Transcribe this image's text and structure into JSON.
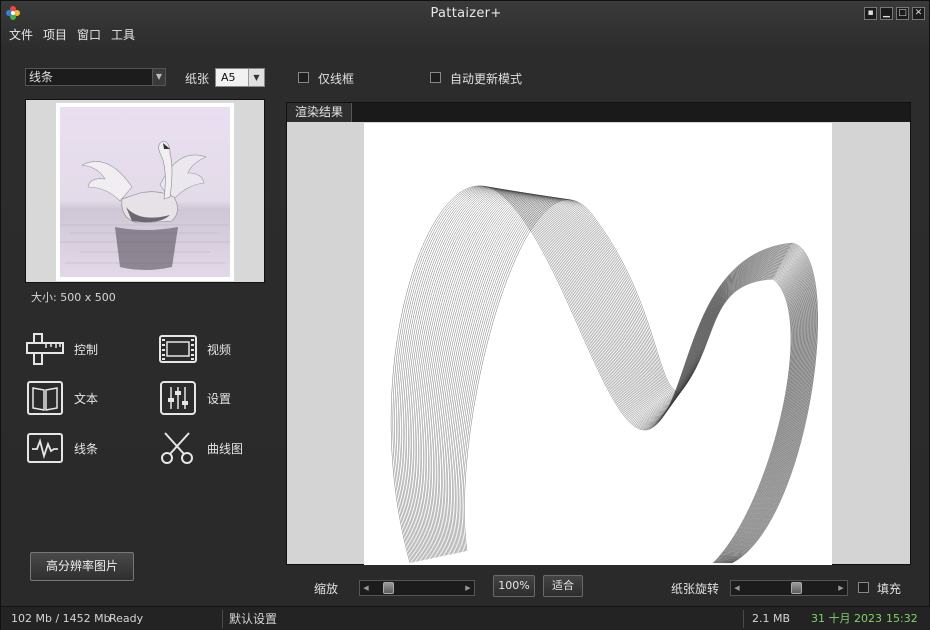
{
  "window": {
    "title": "Pattaizer+",
    "controls": [
      "pin-icon",
      "minimize-icon",
      "maximize-icon",
      "close-icon"
    ]
  },
  "menu": [
    "文件",
    "项目",
    "窗口",
    "工具"
  ],
  "toolbar": {
    "style_select_value": "线条",
    "paper_label": "纸张",
    "paper_value": "A5",
    "wireframe_only_label": "仅线框",
    "auto_update_label": "自动更新模式"
  },
  "preview": {
    "size_label": "大小: 500 x 500"
  },
  "tools": [
    {
      "label": "控制",
      "icon": "ruler-icon"
    },
    {
      "label": "视频",
      "icon": "film-icon"
    },
    {
      "label": "文本",
      "icon": "book-icon"
    },
    {
      "label": "设置",
      "icon": "sliders-icon"
    },
    {
      "label": "线条",
      "icon": "waveform-icon"
    },
    {
      "label": "曲线图",
      "icon": "scissors-icon"
    }
  ],
  "hires_button": "高分辨率图片",
  "render": {
    "tab_label": "渲染结果"
  },
  "bottom": {
    "zoom_label": "缩放",
    "zoom_percent_button": "100%",
    "fit_button": "适合",
    "rotate_label": "纸张旋转",
    "fill_label": "填充"
  },
  "status": {
    "memory": "102 Mb / 1452 Mb",
    "state": "Ready",
    "preset": "默认设置",
    "file_size": "2.1 MB",
    "date": "31 十月 2023",
    "time": "15:32"
  },
  "colors": {
    "background": "#2b2b2b",
    "date_color": "#7fd36a",
    "paper": "#ffffff",
    "canvas_bg": "#d4d4d4"
  }
}
